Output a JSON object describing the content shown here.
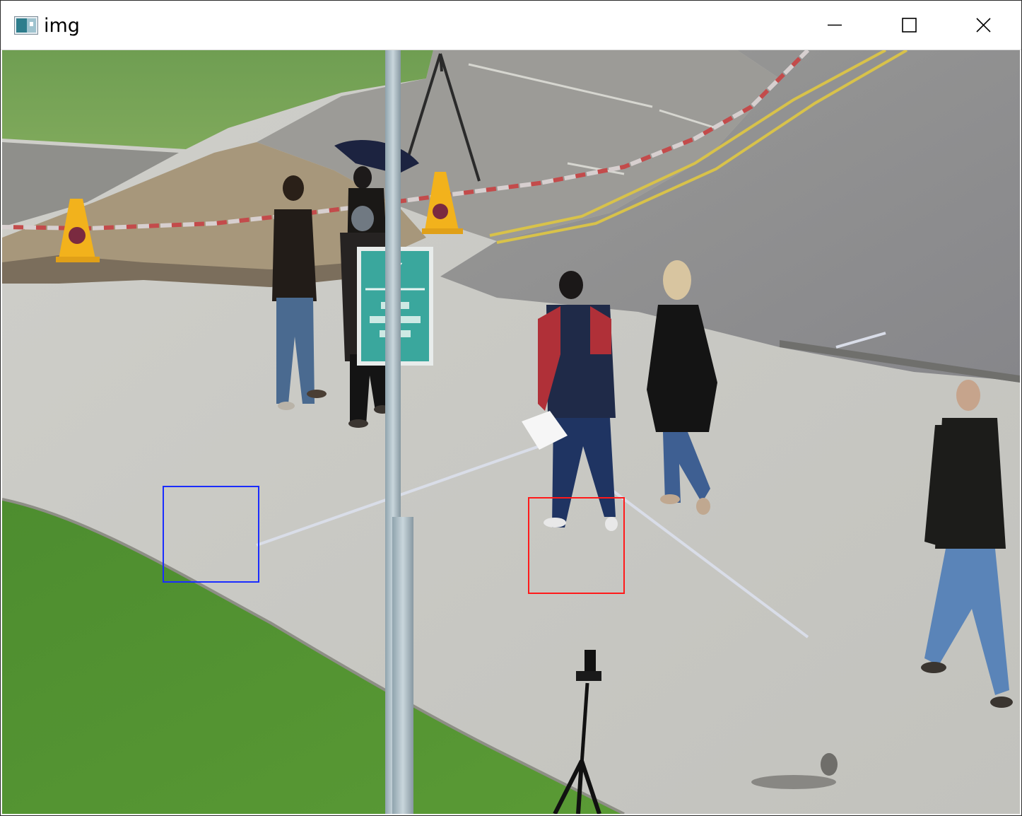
{
  "window": {
    "title": "img",
    "icon": "image-window-icon",
    "controls": [
      {
        "name": "minimize",
        "icon": "minimize-icon"
      },
      {
        "name": "maximize",
        "icon": "maximize-icon"
      },
      {
        "name": "close",
        "icon": "close-icon"
      }
    ]
  },
  "image": {
    "description_icon": "photo-frame",
    "sign_symbol": "✓",
    "detections": [
      {
        "name": "detection-box-blue",
        "color": "#1a2cff"
      },
      {
        "name": "detection-box-red",
        "color": "#ff1a1a"
      }
    ]
  },
  "colors": {
    "grass": "#5f9a3a",
    "pavement": "#c8c8c3",
    "road": "#8d8d8a",
    "sign": "#3aa79d",
    "cone": "#f2b21c"
  }
}
